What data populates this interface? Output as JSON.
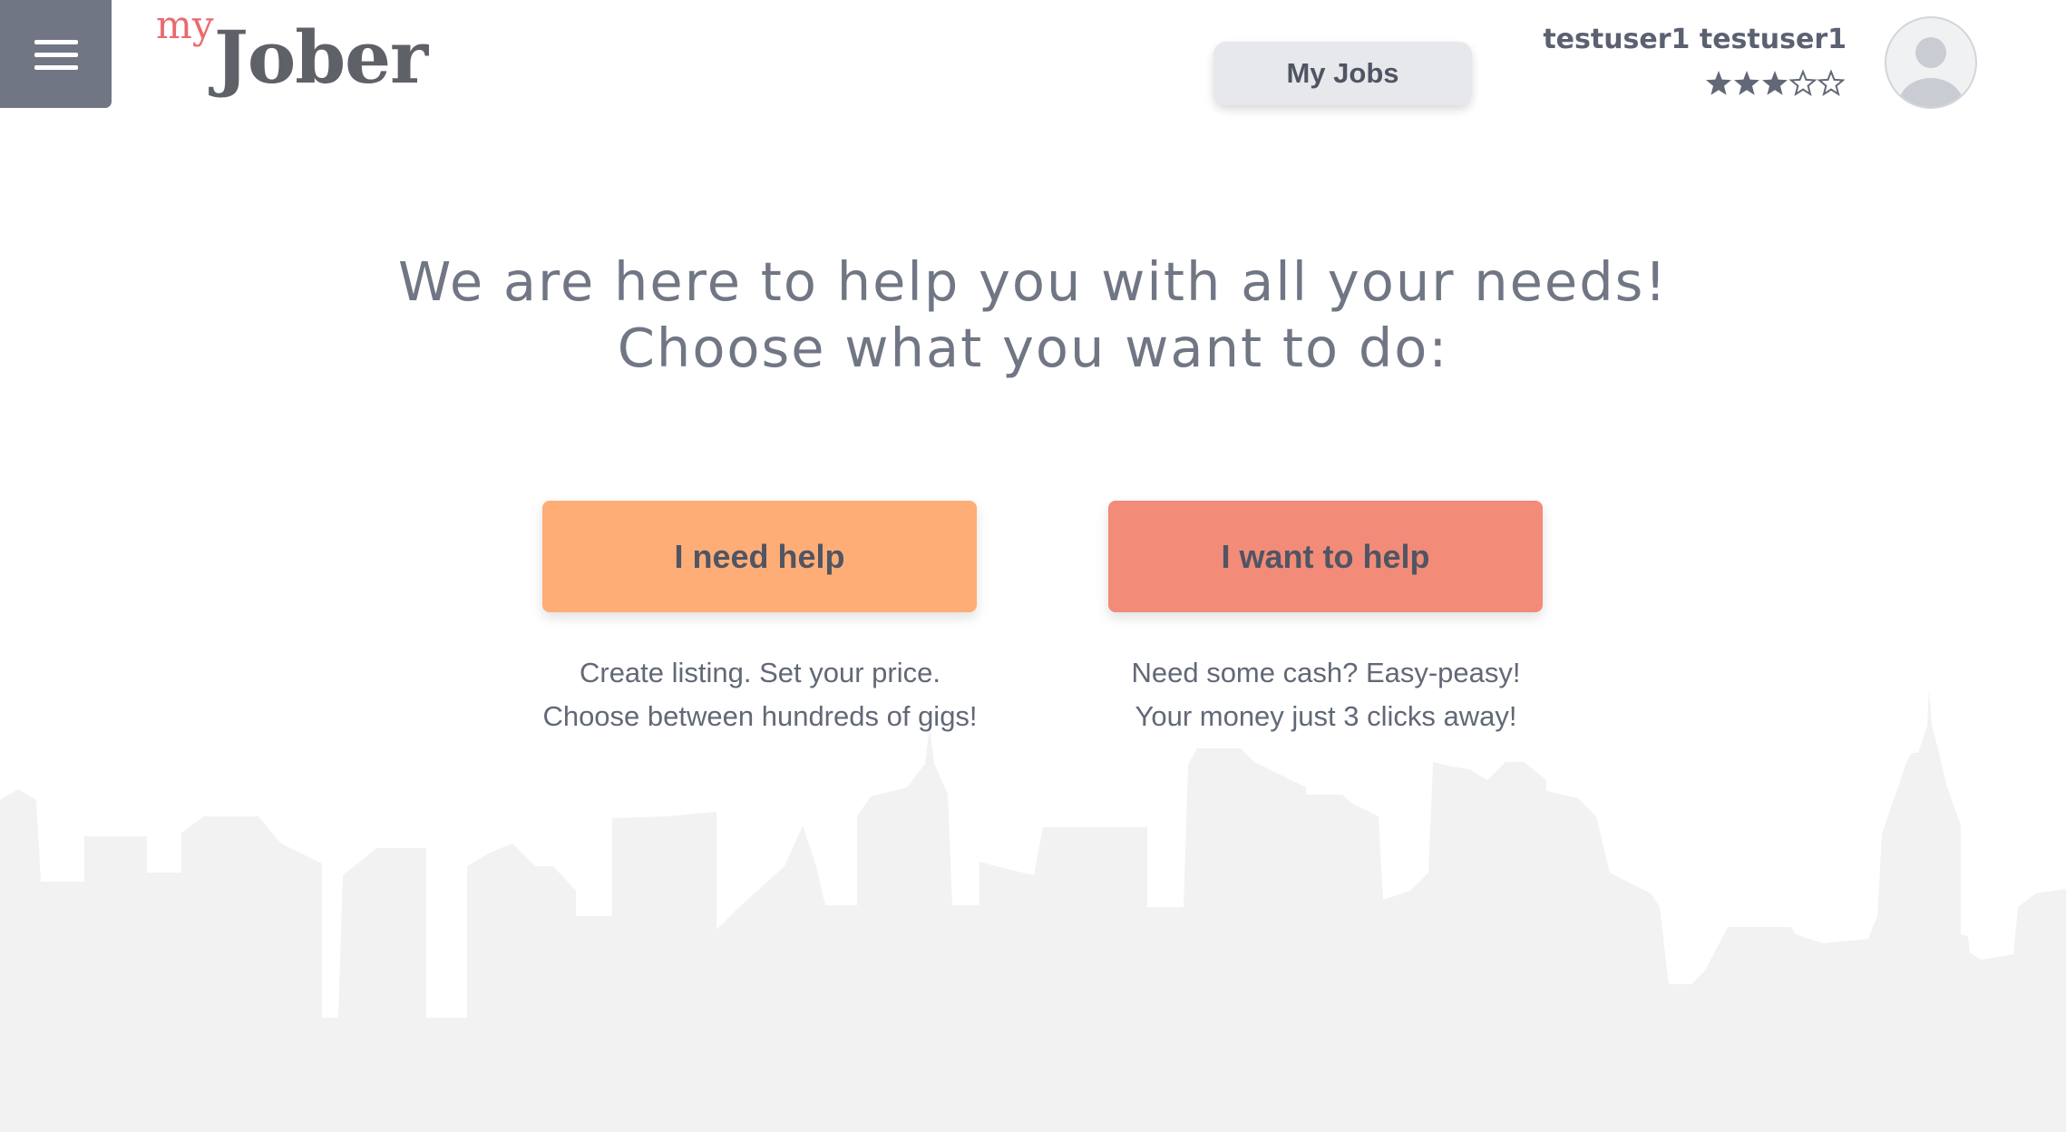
{
  "header": {
    "menu_icon": "hamburger-menu-icon",
    "logo_prefix": "my",
    "logo_name": "Jober",
    "my_jobs_label": "My Jobs"
  },
  "user": {
    "name": "testuser1 testuser1",
    "rating": 3,
    "rating_max": 5,
    "avatar_icon": "user-avatar-icon"
  },
  "main": {
    "headline_line1": "We are here to help you with all your needs!",
    "headline_line2": "Choose what you want to do:",
    "need_help": {
      "label": "I need help",
      "desc_line1": "Create listing. Set your price.",
      "desc_line2": "Choose between hundreds of gigs!"
    },
    "want_help": {
      "label": "I want to help",
      "desc_line1": "Need some cash? Easy-peasy!",
      "desc_line2": "Your money just 3 clicks away!"
    }
  },
  "colors": {
    "need_help_button": "#ffad77",
    "want_help_button": "#f28b78",
    "menu_button": "#707684",
    "logo_accent": "#e86b6d",
    "text": "#707684",
    "skyline": "#f2f2f2"
  }
}
